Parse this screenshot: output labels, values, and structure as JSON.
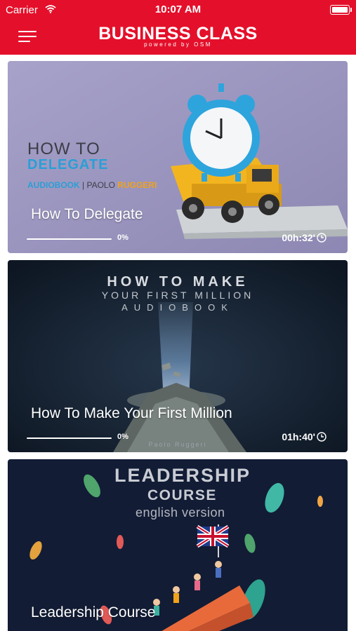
{
  "status_bar": {
    "carrier": "Carrier",
    "time": "10:07 AM"
  },
  "header": {
    "title": "BUSINESS CLASS",
    "subtitle": "powered by OSM"
  },
  "icons": {
    "menu": "hamburger-menu-icon",
    "clock": "clock-icon",
    "wifi": "wifi-icon",
    "battery": "battery-icon"
  },
  "colors": {
    "brand_red": "#e4102b",
    "accent_blue": "#2a9fd6",
    "accent_orange": "#f1a21a"
  },
  "courses": [
    {
      "title": "How To Delegate",
      "progress_percent": 0,
      "progress_label": "0%",
      "duration": "00h:32'",
      "cover": {
        "line1": "HOW TO",
        "line2": "DELEGATE",
        "tag_a": "AUDIOBOOK",
        "tag_sep": "|",
        "tag_b": "PAOLO",
        "tag_c": "RUGGERI"
      }
    },
    {
      "title": "How To Make Your First Million",
      "progress_percent": 0,
      "progress_label": "0%",
      "duration": "01h:40'",
      "cover": {
        "line1": "HOW TO MAKE",
        "line2": "YOUR FIRST MILLION",
        "line3": "AUDIOBOOK",
        "author": "Paolo Ruggeri"
      }
    },
    {
      "title": "Leadership Course",
      "cover": {
        "line1": "LEADERSHIP",
        "line2": "COURSE",
        "line3": "english version"
      }
    }
  ]
}
